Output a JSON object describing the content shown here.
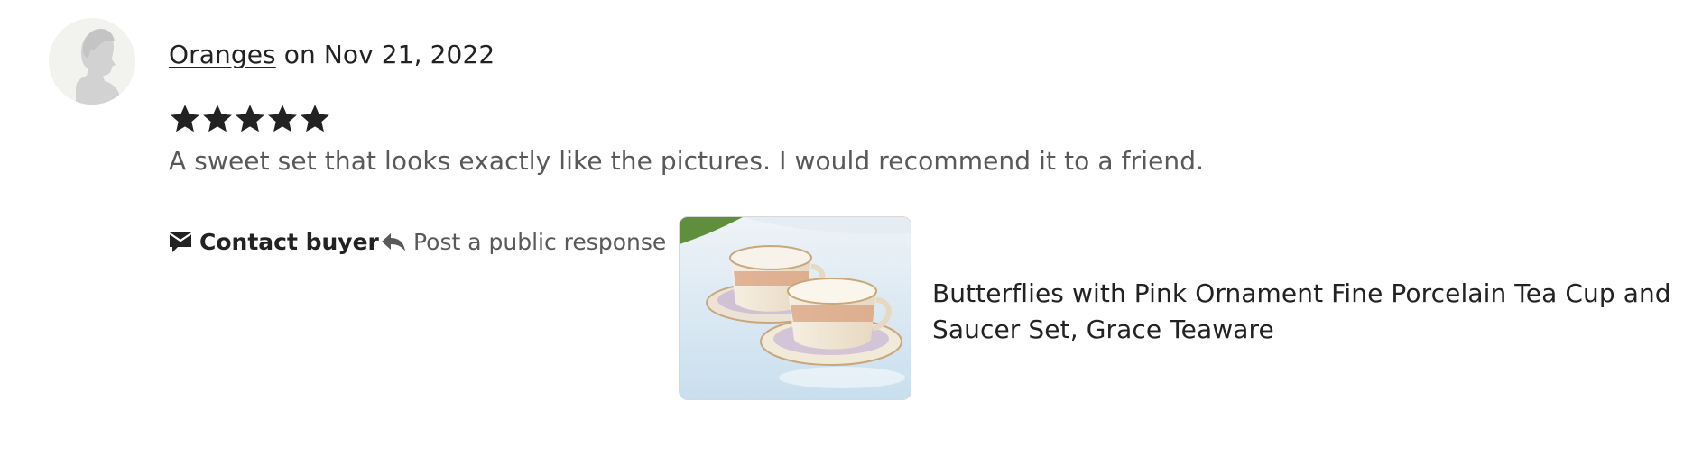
{
  "review": {
    "reviewer_name": "Oranges",
    "date_text": "on Nov 21, 2022",
    "rating": 5,
    "rating_max": 5,
    "text": "A sweet set that looks exactly like the pictures. I would recommend it to a friend."
  },
  "actions": {
    "contact_label": "Contact buyer",
    "response_label": "Post a public response"
  },
  "product": {
    "title": "Butterflies with Pink Ornament Fine Porcelain Tea Cup and Saucer Set, Grace Teaware"
  },
  "icons": {
    "avatar": "default-avatar-icon",
    "star": "star-icon",
    "contact": "envelope-chat-icon",
    "response": "reply-arrow-icon"
  },
  "colors": {
    "text_primary": "#222222",
    "text_secondary": "#595959",
    "avatar_bg": "#f2f2ef",
    "star": "#222222"
  }
}
